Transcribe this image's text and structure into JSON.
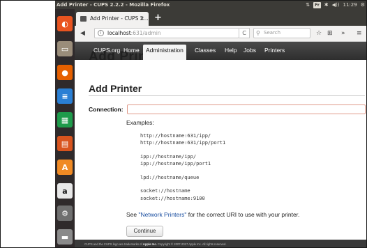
{
  "top_panel": {
    "title": "Add Printer - CUPS 2.2.2 - Mozilla Firefox",
    "keyboard": "Fr",
    "clock": "11:29"
  },
  "launcher": {
    "items": [
      {
        "name": "ubuntu-dash-icon",
        "glyph": "◐",
        "color": "#e95420"
      },
      {
        "name": "files-icon",
        "glyph": "▭",
        "color": "#9a8d7a"
      },
      {
        "name": "firefox-icon",
        "glyph": "●",
        "color": "#e66000"
      },
      {
        "name": "writer-icon",
        "glyph": "≡",
        "color": "#2a7fd4"
      },
      {
        "name": "calc-icon",
        "glyph": "▦",
        "color": "#1e9b4b"
      },
      {
        "name": "impress-icon",
        "glyph": "▤",
        "color": "#d9541e"
      },
      {
        "name": "software-center-icon",
        "glyph": "A",
        "color": "#f08a24"
      },
      {
        "name": "amazon-icon",
        "glyph": "a",
        "color": "#e8e8e8"
      },
      {
        "name": "settings-icon",
        "glyph": "⚙",
        "color": "#6f6f6f"
      },
      {
        "name": "device-icon",
        "glyph": "▬",
        "color": "#8a8a8a"
      }
    ]
  },
  "browser": {
    "tab_title": "Add Printer - CUPS 2...",
    "tab_close": "×",
    "new_tab": "+",
    "url_host": "localhost",
    "url_rest": ":631/admin",
    "search_placeholder": "Search",
    "reload": "C",
    "back": "◀",
    "star": "☆",
    "menu": "≡",
    "overflow": "»",
    "library": "⊞"
  },
  "cups": {
    "ghost_title": "Add Printer",
    "nav": [
      "CUPS.org",
      "Home",
      "Administration",
      "Classes",
      "Help",
      "Jobs",
      "Printers"
    ],
    "active_nav": "Administration",
    "heading": "Add Printer",
    "connection_label": "Connection:",
    "connection_value": "",
    "examples_label": "Examples:",
    "examples": [
      "http://hostname:631/ipp/",
      "http://hostname:631/ipp/port1",
      "ipp://hostname/ipp/",
      "ipp://hostname/ipp/port1",
      "lpd://hostname/queue",
      "socket://hostname",
      "socket://hostname:9100"
    ],
    "see_prefix": "See ",
    "see_link": "\"Network Printers\"",
    "see_suffix": " for the correct URI to use with your printer.",
    "continue_label": "Continue",
    "footer_prefix": "CUPS and the CUPS logo are trademarks of ",
    "footer_brand": "Apple Inc.",
    "footer_suffix": " Copyright © 2007-2017 Apple Inc. All rights reserved."
  }
}
